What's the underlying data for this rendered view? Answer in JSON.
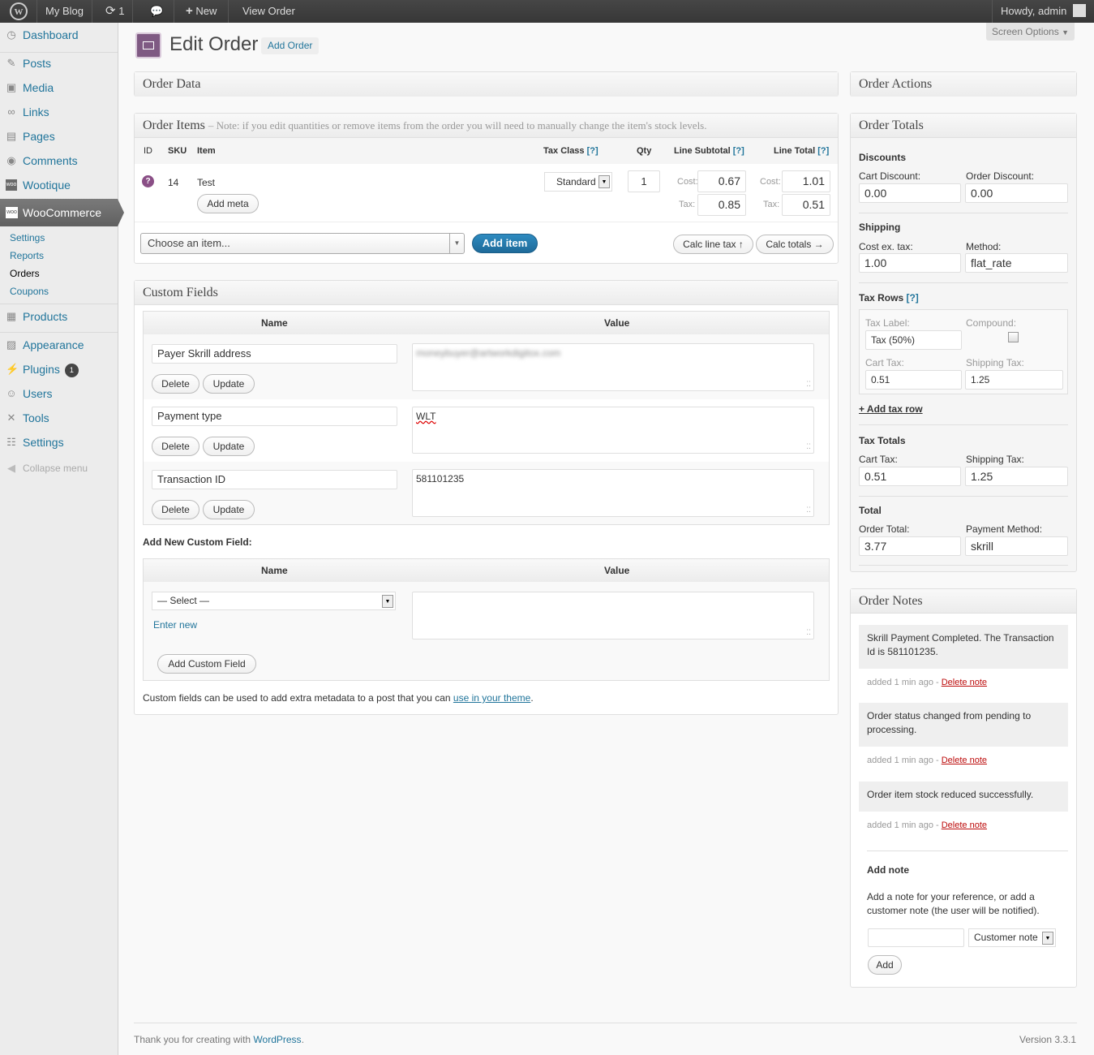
{
  "adminbar": {
    "site": "My Blog",
    "updates": "1",
    "new": "New",
    "view": "View Order",
    "howdy": "Howdy, admin",
    "screen_options": "Screen Options"
  },
  "sidebar": {
    "dashboard": "Dashboard",
    "posts": "Posts",
    "media": "Media",
    "links": "Links",
    "pages": "Pages",
    "comments": "Comments",
    "wootique": "Wootique",
    "woocommerce": "WooCommerce",
    "sub": [
      "Settings",
      "Reports",
      "Orders",
      "Coupons"
    ],
    "products": "Products",
    "appearance": "Appearance",
    "plugins": "Plugins",
    "plugins_badge": "1",
    "users": "Users",
    "tools": "Tools",
    "settings": "Settings",
    "collapse": "Collapse menu"
  },
  "page": {
    "title": "Edit Order",
    "add_order": "Add Order"
  },
  "order_data": {
    "title": "Order Data"
  },
  "order_items": {
    "title": "Order Items",
    "note": "– Note: if you edit quantities or remove items from the order you will need to manually change the item's stock levels.",
    "cols": {
      "id": "ID",
      "sku": "SKU",
      "item": "Item",
      "tax_class": "Tax Class",
      "help": "[?]",
      "qty": "Qty",
      "line_subtotal": "Line Subtotal",
      "line_total": "Line Total"
    },
    "row": {
      "sku": "14",
      "item": "Test",
      "add_meta": "Add meta",
      "tax_class": "Standard",
      "qty": "1",
      "cost_label": "Cost:",
      "tax_label": "Tax:",
      "subtotal_cost": "0.67",
      "subtotal_tax": "0.85",
      "total_cost": "1.01",
      "total_tax": "0.51"
    },
    "choose": "Choose an item...",
    "add_item": "Add item",
    "calc_line_tax": "Calc line tax ↑",
    "calc_totals": "Calc totals →"
  },
  "custom_fields": {
    "title": "Custom Fields",
    "name_col": "Name",
    "value_col": "Value",
    "delete": "Delete",
    "update": "Update",
    "rows": [
      {
        "name": "Payer Skrill address",
        "value": "moneybuyer@artworkdigitox.com"
      },
      {
        "name": "Payment type",
        "value": "WLT"
      },
      {
        "name": "Transaction ID",
        "value": "581101235"
      }
    ],
    "add_new": "Add New Custom Field:",
    "select": "— Select —",
    "enter_new": "Enter new",
    "add_button": "Add Custom Field",
    "help_text": "Custom fields can be used to add extra metadata to a post that you can",
    "help_link": "use in your theme",
    "help_end": "."
  },
  "order_actions": {
    "title": "Order Actions"
  },
  "order_totals": {
    "title": "Order Totals",
    "discounts": "Discounts",
    "cart_discount": "Cart Discount:",
    "cart_discount_val": "0.00",
    "order_discount": "Order Discount:",
    "order_discount_val": "0.00",
    "shipping": "Shipping",
    "cost_ex_tax": "Cost ex. tax:",
    "cost_ex_tax_val": "1.00",
    "method": "Method:",
    "method_val": "flat_rate",
    "tax_rows": "Tax Rows",
    "help": "[?]",
    "tax_label": "Tax Label:",
    "tax_label_val": "Tax (50%)",
    "compound": "Compound:",
    "cart_tax": "Cart Tax:",
    "cart_tax_val": "0.51",
    "shipping_tax": "Shipping Tax:",
    "shipping_tax_val": "1.25",
    "add_tax_row": "+ Add tax row",
    "tax_totals": "Tax Totals",
    "tt_cart_tax": "Cart Tax:",
    "tt_cart_tax_val": "0.51",
    "tt_shipping_tax": "Shipping Tax:",
    "tt_shipping_tax_val": "1.25",
    "total": "Total",
    "order_total": "Order Total:",
    "order_total_val": "3.77",
    "payment_method": "Payment Method:",
    "payment_method_val": "skrill"
  },
  "order_notes": {
    "title": "Order Notes",
    "notes": [
      {
        "text": "Skrill Payment Completed. The Transaction Id is 581101235.",
        "meta": "added 1 min ago - ",
        "del": "Delete note"
      },
      {
        "text": "Order status changed from pending to processing.",
        "meta": "added 1 min ago - ",
        "del": "Delete note"
      },
      {
        "text": "Order item stock reduced successfully.",
        "meta": "added 1 min ago - ",
        "del": "Delete note"
      }
    ],
    "add_note": "Add note",
    "add_note_help": "Add a note for your reference, or add a customer note (the user will be notified).",
    "note_type": "Customer note",
    "add": "Add"
  },
  "footer": {
    "thanks": "Thank you for creating with",
    "wp": "WordPress",
    "dot": ".",
    "version": "Version 3.3.1"
  }
}
